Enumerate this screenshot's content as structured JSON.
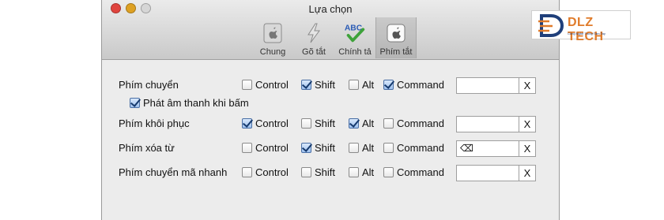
{
  "window": {
    "title": "Lựa chọn",
    "traffic_lights": {
      "close": "#e0443e",
      "minimize": "#dea123",
      "zoom": "#d6d6d6"
    }
  },
  "toolbar": {
    "items": [
      {
        "label": "Chung",
        "icon": "apple-general-icon",
        "selected": false
      },
      {
        "label": "Gõ tắt",
        "icon": "lightning-icon",
        "selected": false
      },
      {
        "label": "Chính tả",
        "icon": "spellcheck-abc-icon",
        "selected": false
      },
      {
        "label": "Phím tắt",
        "icon": "apple-key-icon",
        "selected": true
      }
    ]
  },
  "rows": [
    {
      "label": "Phím chuyển",
      "control": {
        "label": "Control",
        "checked": false
      },
      "shift": {
        "label": "Shift",
        "checked": true
      },
      "alt": {
        "label": "Alt",
        "checked": false
      },
      "command": {
        "label": "Command",
        "checked": true
      },
      "key_value": "",
      "clear_label": "X"
    },
    {
      "label": "Phím khôi phục",
      "control": {
        "label": "Control",
        "checked": true
      },
      "shift": {
        "label": "Shift",
        "checked": false
      },
      "alt": {
        "label": "Alt",
        "checked": true
      },
      "command": {
        "label": "Command",
        "checked": false
      },
      "key_value": "",
      "clear_label": "X"
    },
    {
      "label": "Phím xóa từ",
      "control": {
        "label": "Control",
        "checked": false
      },
      "shift": {
        "label": "Shift",
        "checked": true
      },
      "alt": {
        "label": "Alt",
        "checked": false
      },
      "command": {
        "label": "Command",
        "checked": false
      },
      "key_value": "⌫",
      "clear_label": "X"
    },
    {
      "label": "Phím chuyển mã nhanh",
      "control": {
        "label": "Control",
        "checked": false
      },
      "shift": {
        "label": "Shift",
        "checked": false
      },
      "alt": {
        "label": "Alt",
        "checked": false
      },
      "command": {
        "label": "Command",
        "checked": false
      },
      "key_value": "",
      "clear_label": "X"
    }
  ],
  "beep_option": {
    "label": "Phát âm thanh khi bấm",
    "checked": true
  },
  "logo": {
    "name": "DLZ TECH",
    "tagline": "Công Nghệ Trong Tầm Tay"
  }
}
